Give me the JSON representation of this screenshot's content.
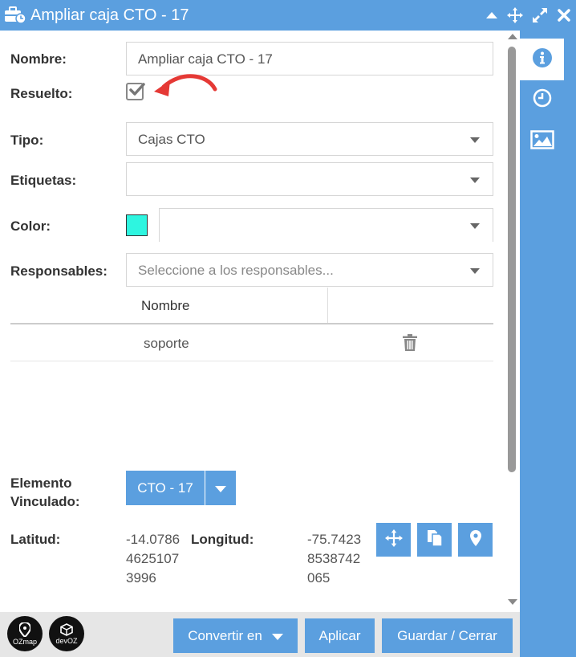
{
  "window": {
    "title": "Ampliar caja CTO - 17"
  },
  "form": {
    "nombre_label": "Nombre:",
    "nombre_value": "Ampliar caja CTO - 17",
    "resuelto_label": "Resuelto:",
    "resuelto_checked": true,
    "tipo_label": "Tipo:",
    "tipo_value": "Cajas CTO",
    "etiquetas_label": "Etiquetas:",
    "etiquetas_value": "",
    "color_label": "Color:",
    "color_value": "#2ef5e0",
    "responsables_label": "Responsables:",
    "responsables_placeholder": "Seleccione a los responsables..."
  },
  "responsables_table": {
    "headers": [
      "Nombre",
      ""
    ],
    "rows": [
      {
        "nombre": "soporte"
      }
    ]
  },
  "elemento": {
    "label": "Elemento Vinculado:",
    "button_label": "CTO - 17"
  },
  "coords": {
    "latitud_label": "Latitud:",
    "latitud_lines": [
      "-14.0786",
      "4625107",
      "3996"
    ],
    "longitud_label": "Longitud:",
    "longitud_lines": [
      "-75.7423",
      "8538742",
      "065"
    ]
  },
  "footer": {
    "logo1": "OZmap",
    "logo2": "devOZ",
    "convertir_label": "Convertir en",
    "aplicar_label": "Aplicar",
    "guardar_label": "Guardar / Cerrar"
  },
  "side_tabs": [
    "info-icon",
    "clock-icon",
    "image-icon"
  ],
  "colors": {
    "accent": "#5b9fdf",
    "annotation_arrow": "#e53935"
  }
}
